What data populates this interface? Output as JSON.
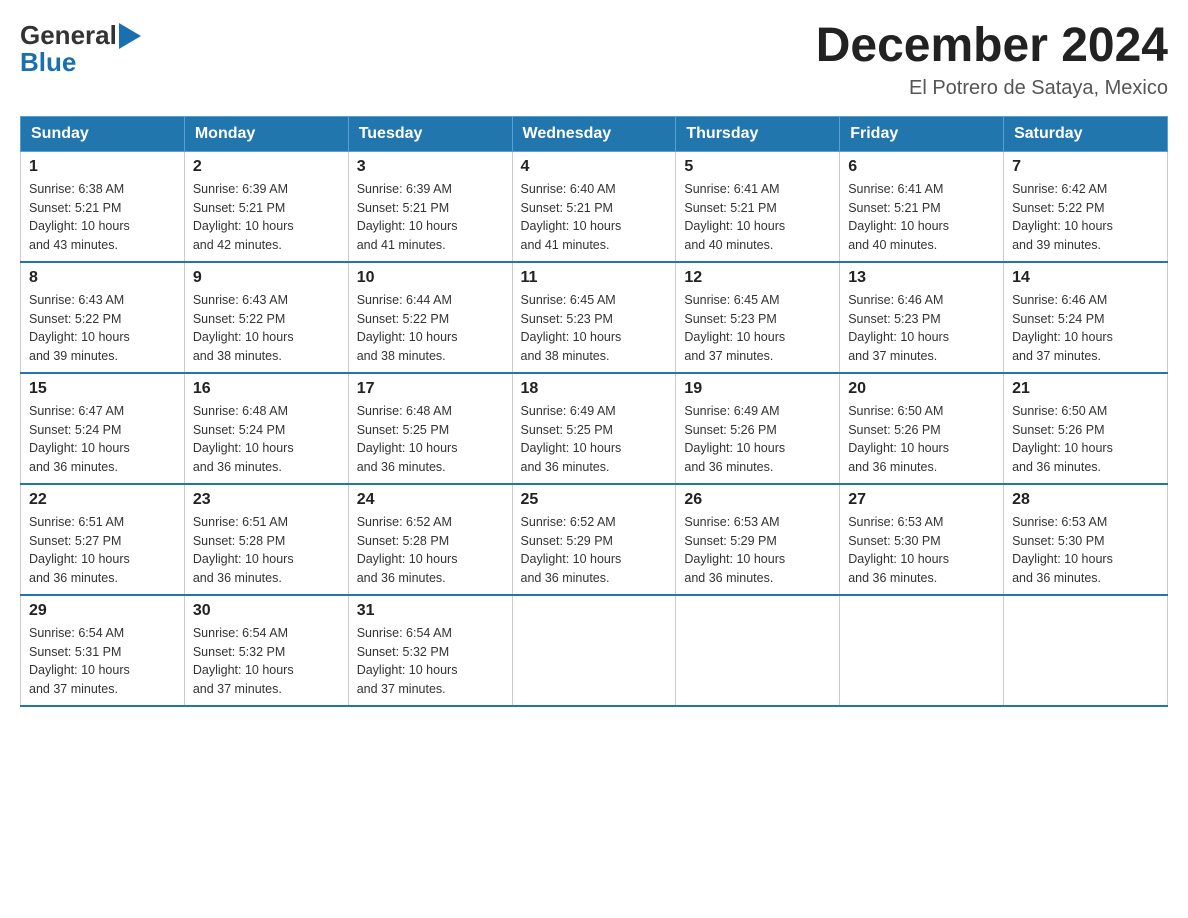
{
  "header": {
    "title": "December 2024",
    "subtitle": "El Potrero de Sataya, Mexico",
    "logo_general": "General",
    "logo_blue": "Blue"
  },
  "columns": [
    "Sunday",
    "Monday",
    "Tuesday",
    "Wednesday",
    "Thursday",
    "Friday",
    "Saturday"
  ],
  "weeks": [
    [
      {
        "day": "1",
        "sunrise": "6:38 AM",
        "sunset": "5:21 PM",
        "daylight": "10 hours and 43 minutes."
      },
      {
        "day": "2",
        "sunrise": "6:39 AM",
        "sunset": "5:21 PM",
        "daylight": "10 hours and 42 minutes."
      },
      {
        "day": "3",
        "sunrise": "6:39 AM",
        "sunset": "5:21 PM",
        "daylight": "10 hours and 41 minutes."
      },
      {
        "day": "4",
        "sunrise": "6:40 AM",
        "sunset": "5:21 PM",
        "daylight": "10 hours and 41 minutes."
      },
      {
        "day": "5",
        "sunrise": "6:41 AM",
        "sunset": "5:21 PM",
        "daylight": "10 hours and 40 minutes."
      },
      {
        "day": "6",
        "sunrise": "6:41 AM",
        "sunset": "5:21 PM",
        "daylight": "10 hours and 40 minutes."
      },
      {
        "day": "7",
        "sunrise": "6:42 AM",
        "sunset": "5:22 PM",
        "daylight": "10 hours and 39 minutes."
      }
    ],
    [
      {
        "day": "8",
        "sunrise": "6:43 AM",
        "sunset": "5:22 PM",
        "daylight": "10 hours and 39 minutes."
      },
      {
        "day": "9",
        "sunrise": "6:43 AM",
        "sunset": "5:22 PM",
        "daylight": "10 hours and 38 minutes."
      },
      {
        "day": "10",
        "sunrise": "6:44 AM",
        "sunset": "5:22 PM",
        "daylight": "10 hours and 38 minutes."
      },
      {
        "day": "11",
        "sunrise": "6:45 AM",
        "sunset": "5:23 PM",
        "daylight": "10 hours and 38 minutes."
      },
      {
        "day": "12",
        "sunrise": "6:45 AM",
        "sunset": "5:23 PM",
        "daylight": "10 hours and 37 minutes."
      },
      {
        "day": "13",
        "sunrise": "6:46 AM",
        "sunset": "5:23 PM",
        "daylight": "10 hours and 37 minutes."
      },
      {
        "day": "14",
        "sunrise": "6:46 AM",
        "sunset": "5:24 PM",
        "daylight": "10 hours and 37 minutes."
      }
    ],
    [
      {
        "day": "15",
        "sunrise": "6:47 AM",
        "sunset": "5:24 PM",
        "daylight": "10 hours and 36 minutes."
      },
      {
        "day": "16",
        "sunrise": "6:48 AM",
        "sunset": "5:24 PM",
        "daylight": "10 hours and 36 minutes."
      },
      {
        "day": "17",
        "sunrise": "6:48 AM",
        "sunset": "5:25 PM",
        "daylight": "10 hours and 36 minutes."
      },
      {
        "day": "18",
        "sunrise": "6:49 AM",
        "sunset": "5:25 PM",
        "daylight": "10 hours and 36 minutes."
      },
      {
        "day": "19",
        "sunrise": "6:49 AM",
        "sunset": "5:26 PM",
        "daylight": "10 hours and 36 minutes."
      },
      {
        "day": "20",
        "sunrise": "6:50 AM",
        "sunset": "5:26 PM",
        "daylight": "10 hours and 36 minutes."
      },
      {
        "day": "21",
        "sunrise": "6:50 AM",
        "sunset": "5:26 PM",
        "daylight": "10 hours and 36 minutes."
      }
    ],
    [
      {
        "day": "22",
        "sunrise": "6:51 AM",
        "sunset": "5:27 PM",
        "daylight": "10 hours and 36 minutes."
      },
      {
        "day": "23",
        "sunrise": "6:51 AM",
        "sunset": "5:28 PM",
        "daylight": "10 hours and 36 minutes."
      },
      {
        "day": "24",
        "sunrise": "6:52 AM",
        "sunset": "5:28 PM",
        "daylight": "10 hours and 36 minutes."
      },
      {
        "day": "25",
        "sunrise": "6:52 AM",
        "sunset": "5:29 PM",
        "daylight": "10 hours and 36 minutes."
      },
      {
        "day": "26",
        "sunrise": "6:53 AM",
        "sunset": "5:29 PM",
        "daylight": "10 hours and 36 minutes."
      },
      {
        "day": "27",
        "sunrise": "6:53 AM",
        "sunset": "5:30 PM",
        "daylight": "10 hours and 36 minutes."
      },
      {
        "day": "28",
        "sunrise": "6:53 AM",
        "sunset": "5:30 PM",
        "daylight": "10 hours and 36 minutes."
      }
    ],
    [
      {
        "day": "29",
        "sunrise": "6:54 AM",
        "sunset": "5:31 PM",
        "daylight": "10 hours and 37 minutes."
      },
      {
        "day": "30",
        "sunrise": "6:54 AM",
        "sunset": "5:32 PM",
        "daylight": "10 hours and 37 minutes."
      },
      {
        "day": "31",
        "sunrise": "6:54 AM",
        "sunset": "5:32 PM",
        "daylight": "10 hours and 37 minutes."
      },
      null,
      null,
      null,
      null
    ]
  ],
  "sunrise_label": "Sunrise:",
  "sunset_label": "Sunset:",
  "daylight_label": "Daylight:"
}
